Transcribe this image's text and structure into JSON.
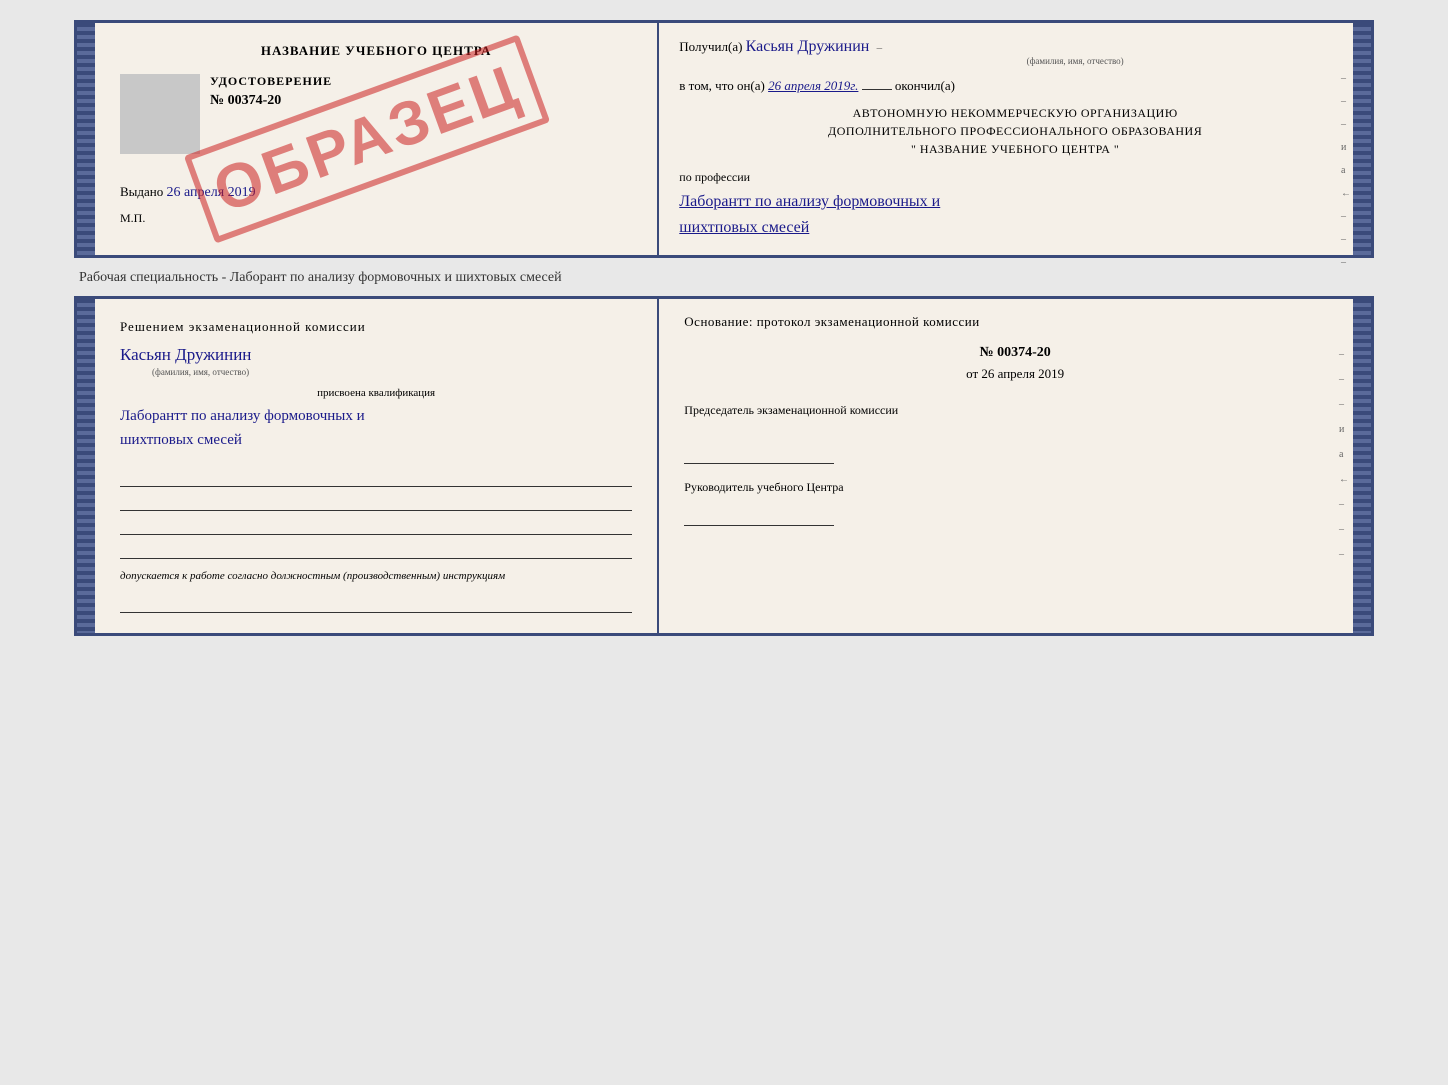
{
  "page": {
    "background": "#e8e8e8"
  },
  "cert_top": {
    "left": {
      "title": "НАЗВАНИЕ УЧЕБНОГО ЦЕНТРА",
      "stamp_label": "УДОСТОВЕРЕНИЕ",
      "stamp_num": "№ 00374-20",
      "vydano_label": "Выдано",
      "vydano_date": "26 апреля 2019",
      "mp": "М.П."
    },
    "obrazets": "ОБРАЗЕЦ",
    "right": {
      "poluchil_label": "Получил(а)",
      "poluchil_name": "Касьян Дружинин",
      "fio_sublabel": "(фамилия, имя, отчество)",
      "vtom_label": "в том, что он(а)",
      "vtom_date": "26 апреля 2019г.",
      "okonchil": "окончил(а)",
      "org_line1": "АВТОНОМНУЮ НЕКОММЕРЧЕСКУЮ ОРГАНИЗАЦИЮ",
      "org_line2": "ДОПОЛНИТЕЛЬНОГО ПРОФЕССИОНАЛЬНОГО ОБРАЗОВАНИЯ",
      "org_line3": "\"   НАЗВАНИЕ УЧЕБНОГО ЦЕНТРА   \"",
      "profession_label": "по профессии",
      "profession_name": "Лаборантт по анализу формовочных и шихтповых смесей",
      "side_marks": [
        "–",
        "–",
        "–",
        "и",
        "а",
        "←",
        "–",
        "–",
        "–"
      ]
    }
  },
  "spacer": {
    "text": "Рабочая специальность - Лаборант по анализу формовочных и шихтовых смесей"
  },
  "cert_bottom": {
    "left": {
      "resheniem": "Решением  экзаменационной  комиссии",
      "name": "Касьян  Дружинин",
      "fio_label": "(фамилия, имя, отчество)",
      "prisvoena": "присвоена квалификация",
      "qualification": "Лаборантт по анализу формовочных и шихтповых смесей",
      "dopuskaetsya": "допускается к  работе согласно должностным (производственным) инструкциям"
    },
    "right": {
      "osnovanie": "Основание: протокол экзаменационной  комиссии",
      "num": "№  00374-20",
      "ot_label": "от",
      "date": "26 апреля 2019",
      "predsedatel": "Председатель экзаменационной комиссии",
      "rukovoditel": "Руководитель учебного Центра",
      "side_marks": [
        "–",
        "–",
        "–",
        "и",
        "а",
        "←",
        "–",
        "–",
        "–"
      ]
    }
  }
}
